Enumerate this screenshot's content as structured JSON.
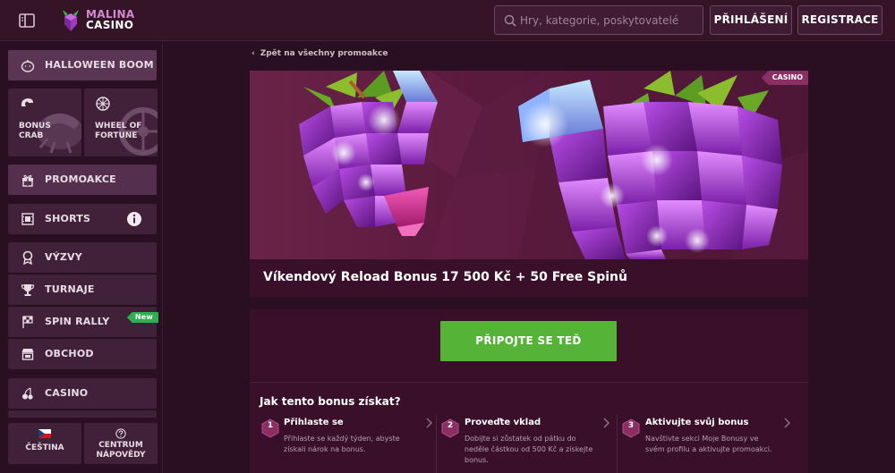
{
  "header": {
    "logo_line1": "MALINA",
    "logo_line2": "CASINO",
    "search_placeholder": "Hry, kategorie, poskytovatelé",
    "login_label": "PŘIHLÁŠENÍ",
    "register_label": "REGISTRACE"
  },
  "sidebar": {
    "halloween_label": "HALLOWEEN BOOM",
    "tiles": [
      {
        "label_line1": "BONUS",
        "label_line2": "CRAB"
      },
      {
        "label_line1": "WHEEL OF",
        "label_line2": "FORTUNE"
      }
    ],
    "items": [
      {
        "label": "PROMOAKCE",
        "icon": "gift-icon"
      },
      {
        "label": "SHORTS",
        "icon": "film-icon"
      },
      {
        "label": "VÝZVY",
        "icon": "badge-icon"
      },
      {
        "label": "TURNAJE",
        "icon": "trophy-icon"
      },
      {
        "label": "SPIN RALLY",
        "icon": "flag-icon",
        "badge": "New"
      },
      {
        "label": "OBCHOD",
        "icon": "shop-icon"
      },
      {
        "label": "CASINO",
        "icon": "cherries-icon"
      }
    ],
    "language_label": "ČEŠTINA",
    "help_line1": "CENTRUM",
    "help_line2": "NÁPOVĚDY"
  },
  "main": {
    "back_link": "Zpět na všechny promoakce",
    "banner_badge": "CASINO",
    "promo_title": "Víkendový Reload Bonus 17 500 Kč + 50 Free Spinů",
    "cta_label": "PŘIPOJTE SE TEĎ",
    "how_title": "Jak tento bonus získat?",
    "steps": [
      {
        "number": "1",
        "title": "Přihlaste se",
        "description": "Přihlaste se každý týden, abyste získali nárok na bonus."
      },
      {
        "number": "2",
        "title": "Proveďte vklad",
        "description": "Dobijte si zůstatek od pátku do neděle částkou od 500 Kč a získejte bonus."
      },
      {
        "number": "3",
        "title": "Aktivujte svůj bonus",
        "description": "Navštivte sekci Moje Bonusy ve svém profilu a aktivujte promoakci."
      }
    ]
  },
  "colors": {
    "background": "#2a0f22",
    "accent_green": "#55b437",
    "new_badge": "#2fb04f",
    "casino_badge": "#8a2e63"
  }
}
